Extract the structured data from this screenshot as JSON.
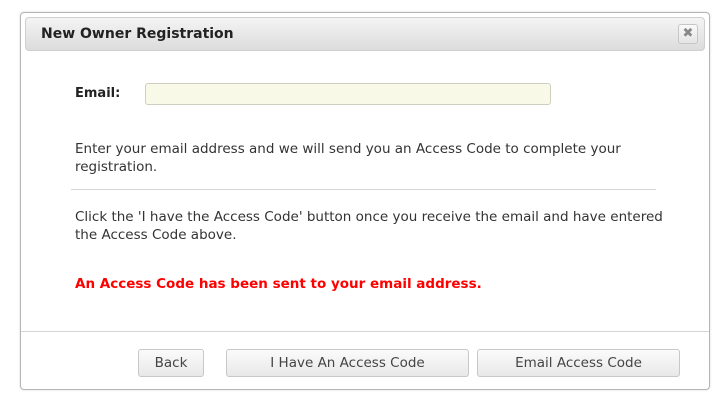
{
  "dialog": {
    "title": "New Owner Registration",
    "close_glyph": "✖"
  },
  "form": {
    "email_label": "Email:",
    "email_value": "",
    "email_placeholder": ""
  },
  "instructions": {
    "paragraph1": "Enter your email address and we will send you an Access Code to complete your registration.",
    "paragraph2": "Click the 'I have the Access Code' button once you receive the email and have entered the Access Code above."
  },
  "status": {
    "message": "An Access Code has been sent to your email address.",
    "color": "#ff0000"
  },
  "buttons": {
    "back": "Back",
    "have_code": "I Have An Access Code",
    "email_code": "Email Access Code"
  },
  "icons": {
    "close": "close-icon"
  }
}
